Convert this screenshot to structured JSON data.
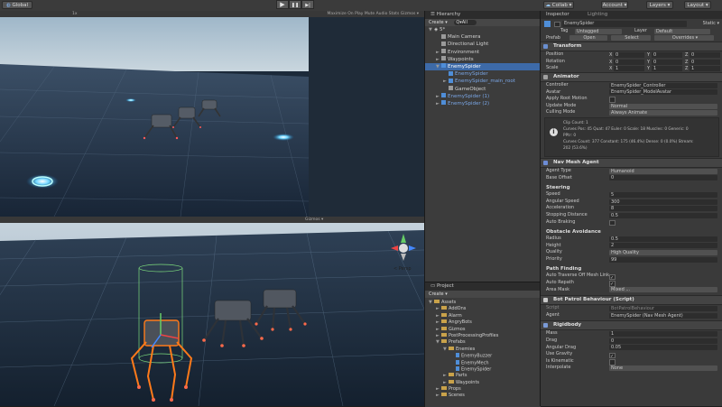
{
  "toolbar": {
    "left_label": "Global",
    "play_icons": [
      "▶",
      "❚❚",
      "▶|"
    ],
    "collab": "Collab ▾",
    "account": "Account ▾",
    "layers": "Layers ▾",
    "layout": "Layout ▾"
  },
  "scene_top": {
    "tabbar_text": "1x",
    "right_text": "Maximize On Play   Mute Audio   Stats   Gizmos ▾"
  },
  "scene_bottom": {
    "tabbar_text": "Gizmos ▾",
    "persp_label": "< Persp"
  },
  "hierarchy": {
    "tab": "Hierarchy",
    "create": "Create ▾",
    "search": "Q▾All",
    "scene": "5*",
    "items": [
      {
        "label": "Main Camera",
        "indent": 1,
        "arrow": ""
      },
      {
        "label": "Directional Light",
        "indent": 1,
        "arrow": ""
      },
      {
        "label": "Environment",
        "indent": 1,
        "arrow": "►"
      },
      {
        "label": "Waypoints",
        "indent": 1,
        "arrow": "►"
      },
      {
        "label": "EnemySpider",
        "indent": 1,
        "arrow": "▼",
        "selected": true
      },
      {
        "label": "EnemySpider",
        "indent": 2,
        "arrow": "",
        "blue": true
      },
      {
        "label": "EnemySpider_main_root",
        "indent": 2,
        "arrow": "►",
        "blue": true
      },
      {
        "label": "GameObject",
        "indent": 2,
        "arrow": ""
      },
      {
        "label": "EnemySpider (1)",
        "indent": 1,
        "arrow": "►",
        "blue": true
      },
      {
        "label": "EnemySpider (2)",
        "indent": 1,
        "arrow": "►",
        "blue": true
      }
    ]
  },
  "project": {
    "tab": "Project",
    "create": "Create ▾",
    "items": [
      {
        "label": "Assets",
        "indent": 0,
        "arrow": "▼"
      },
      {
        "label": "AddOns",
        "indent": 1,
        "arrow": "►"
      },
      {
        "label": "Alarm",
        "indent": 1,
        "arrow": "►"
      },
      {
        "label": "AngryBots",
        "indent": 1,
        "arrow": "►"
      },
      {
        "label": "Gizmos",
        "indent": 1,
        "arrow": "►"
      },
      {
        "label": "PostProcessingProfiles",
        "indent": 1,
        "arrow": "►"
      },
      {
        "label": "Prefabs",
        "indent": 1,
        "arrow": "▼"
      },
      {
        "label": "Enemies",
        "indent": 2,
        "arrow": "▼"
      },
      {
        "label": "EnemyBuzzer",
        "indent": 3,
        "arrow": "",
        "file": true
      },
      {
        "label": "EnemyMech",
        "indent": 3,
        "arrow": "",
        "file": true
      },
      {
        "label": "EnemySpider",
        "indent": 3,
        "arrow": "",
        "file": true
      },
      {
        "label": "Parts",
        "indent": 2,
        "arrow": "►"
      },
      {
        "label": "Waypoints",
        "indent": 2,
        "arrow": "►"
      },
      {
        "label": "Props",
        "indent": 1,
        "arrow": "►"
      },
      {
        "label": "Scenes",
        "indent": 1,
        "arrow": "►"
      }
    ]
  },
  "inspector": {
    "tab": "Inspector",
    "tab2": "Lighting",
    "object_name": "EnemySpider",
    "static_label": "Static ▾",
    "tag_label": "Tag",
    "tag_value": "Untagged",
    "layer_label": "Layer",
    "layer_value": "Default",
    "prefab_label": "Prefab",
    "prefab_open": "Open",
    "prefab_select": "Select",
    "prefab_overrides": "Overrides ▾",
    "transform": {
      "title": "Transform",
      "rows": [
        {
          "label": "Position",
          "x": "0",
          "y": "0",
          "z": "0"
        },
        {
          "label": "Rotation",
          "x": "0",
          "y": "0",
          "z": "0"
        },
        {
          "label": "Scale",
          "x": "1",
          "y": "1",
          "z": "1"
        }
      ]
    },
    "animator": {
      "title": "Animator",
      "controller_label": "Controller",
      "controller_value": "EnemySpider_Controller",
      "avatar_label": "Avatar",
      "avatar_value": "EnemySpider_ModelAvatar",
      "root_motion_label": "Apply Root Motion",
      "update_mode_label": "Update Mode",
      "update_mode_value": "Normal",
      "culling_mode_label": "Culling Mode",
      "culling_mode_value": "Always Animate",
      "info": [
        "Clip Count: 1",
        "Curves Pos: 45 Quat: 47 Euler: 0 Scale: 18 Muscles: 0 Generic: 0",
        "PPtr: 0",
        "Curves Count: 377 Constant: 175 (46.4%) Dense: 0 (0.0%) Stream:",
        "202 (53.6%)"
      ]
    },
    "nav_mesh_agent": {
      "title": "Nav Mesh Agent",
      "agent_type_label": "Agent Type",
      "agent_type_value": "Humanoid",
      "base_offset_label": "Base Offset",
      "base_offset_value": "0",
      "steering_label": "Steering",
      "speed_label": "Speed",
      "speed_value": "5",
      "angular_speed_label": "Angular Speed",
      "angular_speed_value": "300",
      "acceleration_label": "Acceleration",
      "acceleration_value": "8",
      "stopping_distance_label": "Stopping Distance",
      "stopping_distance_value": "0.5",
      "auto_braking_label": "Auto Braking",
      "obstacle_label": "Obstacle Avoidance",
      "radius_label": "Radius",
      "radius_value": "0.5",
      "height_label": "Height",
      "height_value": "2",
      "quality_label": "Quality",
      "quality_value": "High Quality",
      "priority_label": "Priority",
      "priority_value": "99",
      "pathfinding_label": "Path Finding",
      "auto_traverse_label": "Auto Traverse Off Mesh Link",
      "auto_repath_label": "Auto Repath",
      "area_mask_label": "Area Mask",
      "area_mask_value": "Mixed ..."
    },
    "bot_patrol": {
      "title": "Bot Patrol Behaviour (Script)",
      "script_label": "Script",
      "script_value": "BotPatrolBehaviour",
      "agent_label": "Agent",
      "agent_value": "EnemySpider (Nav Mesh Agent)"
    },
    "rigidbody": {
      "title": "Rigidbody",
      "mass_label": "Mass",
      "mass_value": "1",
      "drag_label": "Drag",
      "drag_value": "0",
      "angular_drag_label": "Angular Drag",
      "angular_drag_value": "0.05",
      "use_gravity_label": "Use Gravity",
      "is_kinematic_label": "Is Kinematic",
      "interpolate_label": "Interpolate",
      "interpolate_value": "None"
    }
  },
  "colors": {
    "selection": "#3d6aa8",
    "prefab_blue": "#7aa6e6",
    "glow": "#48c8ff",
    "selection_outline": "#ff7a1a"
  }
}
